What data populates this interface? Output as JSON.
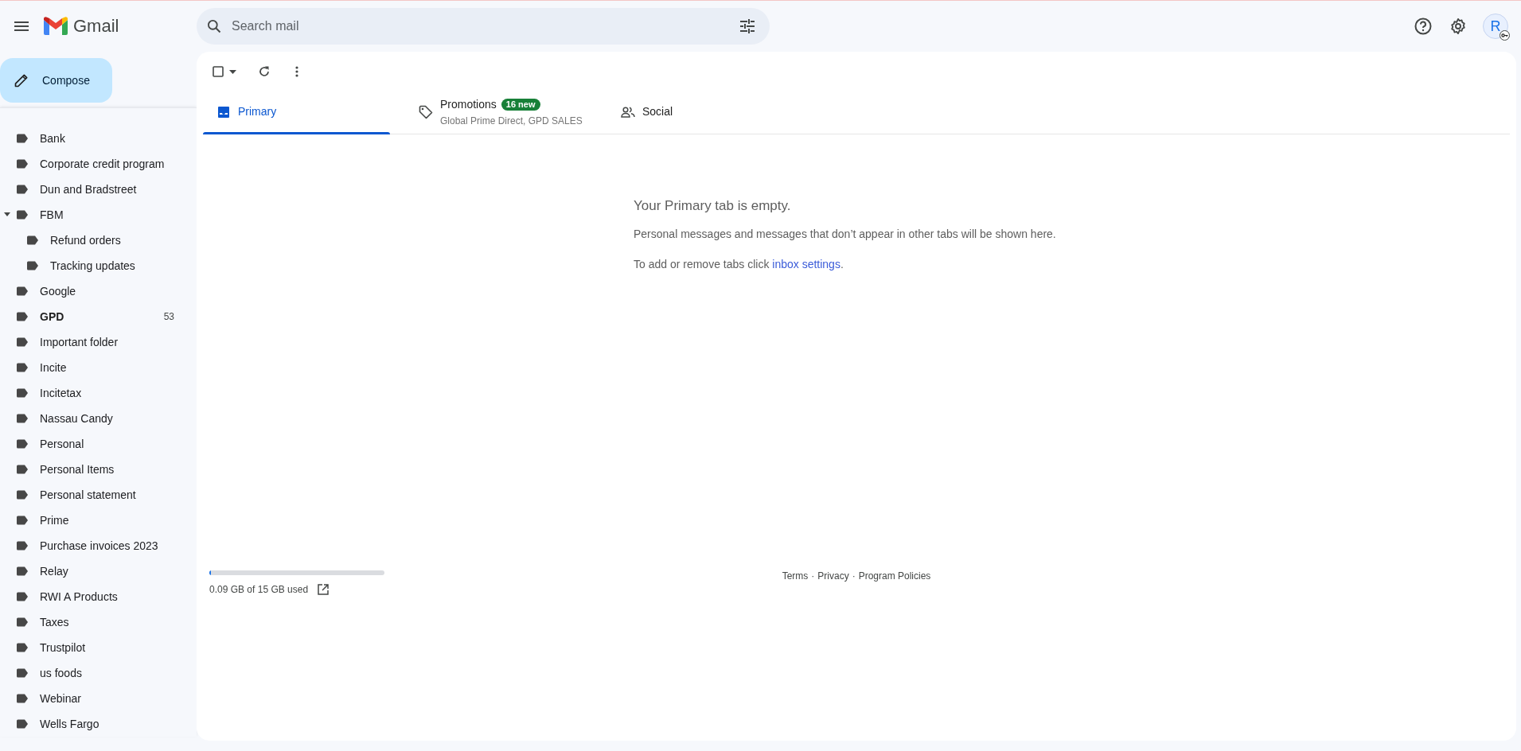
{
  "app": {
    "name": "Gmail"
  },
  "search": {
    "placeholder": "Search mail"
  },
  "account": {
    "initial": "R"
  },
  "compose": {
    "label": "Compose"
  },
  "sidebar": {
    "labels": [
      {
        "label": "Bank"
      },
      {
        "label": "Corporate credit program"
      },
      {
        "label": "Dun and Bradstreet"
      },
      {
        "label": "FBM",
        "expanded": true,
        "children": [
          {
            "label": "Refund orders"
          },
          {
            "label": "Tracking updates"
          }
        ]
      },
      {
        "label": "Google"
      },
      {
        "label": "GPD",
        "unread": true,
        "count": "53"
      },
      {
        "label": "Important folder"
      },
      {
        "label": "Incite"
      },
      {
        "label": "Incitetax"
      },
      {
        "label": "Nassau Candy"
      },
      {
        "label": "Personal"
      },
      {
        "label": "Personal Items"
      },
      {
        "label": "Personal statement"
      },
      {
        "label": "Prime"
      },
      {
        "label": "Purchase invoices 2023"
      },
      {
        "label": "Relay"
      },
      {
        "label": "RWI A Products"
      },
      {
        "label": "Taxes"
      },
      {
        "label": "Trustpilot"
      },
      {
        "label": "us foods"
      },
      {
        "label": "Webinar"
      },
      {
        "label": "Wells Fargo"
      }
    ]
  },
  "tabs": [
    {
      "kind": "inbox",
      "label": "Primary",
      "selected": true
    },
    {
      "kind": "tag",
      "label": "Promotions",
      "badge": "16 new",
      "subtitle": "Global Prime Direct, GPD SALES",
      "selected": false
    },
    {
      "kind": "people",
      "label": "Social",
      "selected": false
    }
  ],
  "empty_state": {
    "title": "Your Primary tab is empty.",
    "message": "Personal messages and messages that don’t appear in other tabs will be shown here.",
    "hint": "To add or remove tabs click",
    "link": "inbox settings",
    "hint_end": "."
  },
  "storage": {
    "level": 0.01,
    "text": "0.09 GB of 15 GB used"
  },
  "footer": {
    "links": [
      "Terms",
      "Privacy",
      "Program Policies"
    ],
    "separator": "·"
  }
}
